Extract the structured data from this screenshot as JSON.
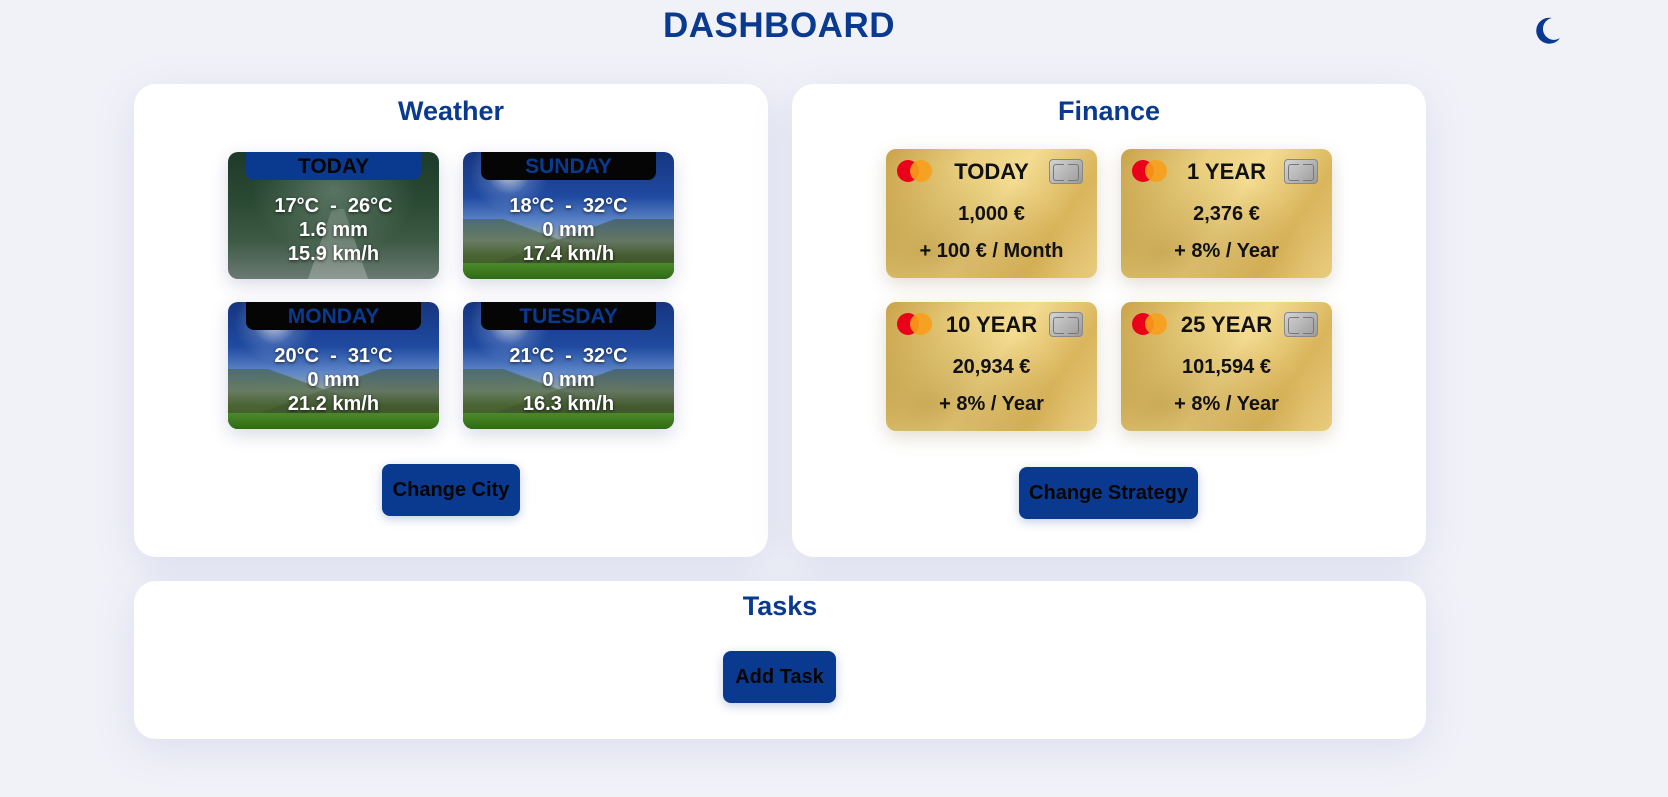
{
  "header": {
    "title": "DASHBOARD",
    "theme_icon": "moon-icon"
  },
  "weather": {
    "title": "Weather",
    "cards": [
      {
        "day": "TODAY",
        "temp": "17°C  -  26°C",
        "rain": "1.6 mm",
        "wind": "15.9 km/h",
        "scene": "rain"
      },
      {
        "day": "SUNDAY",
        "temp": "18°C  -  32°C",
        "rain": "0 mm",
        "wind": "17.4 km/h",
        "scene": "sun"
      },
      {
        "day": "MONDAY",
        "temp": "20°C  -  31°C",
        "rain": "0 mm",
        "wind": "21.2 km/h",
        "scene": "sun"
      },
      {
        "day": "TUESDAY",
        "temp": "21°C  -  32°C",
        "rain": "0 mm",
        "wind": "16.3 km/h",
        "scene": "sun"
      }
    ],
    "button_label": "Change City"
  },
  "finance": {
    "title": "Finance",
    "cards": [
      {
        "period": "TODAY",
        "amount": "1,000 €",
        "rate": "+ 100 € / Month"
      },
      {
        "period": "1 YEAR",
        "amount": "2,376 €",
        "rate": "+ 8% / Year"
      },
      {
        "period": "10 YEAR",
        "amount": "20,934 €",
        "rate": "+ 8% / Year"
      },
      {
        "period": "25 YEAR",
        "amount": "101,594 €",
        "rate": "+ 8% / Year"
      }
    ],
    "button_label": "Change Strategy"
  },
  "tasks": {
    "title": "Tasks",
    "button_label": "Add Task"
  },
  "colors": {
    "accent": "#0a3a8f",
    "background": "#f1f2f8",
    "panel": "#ffffff",
    "gold": "#e9cf7e"
  }
}
